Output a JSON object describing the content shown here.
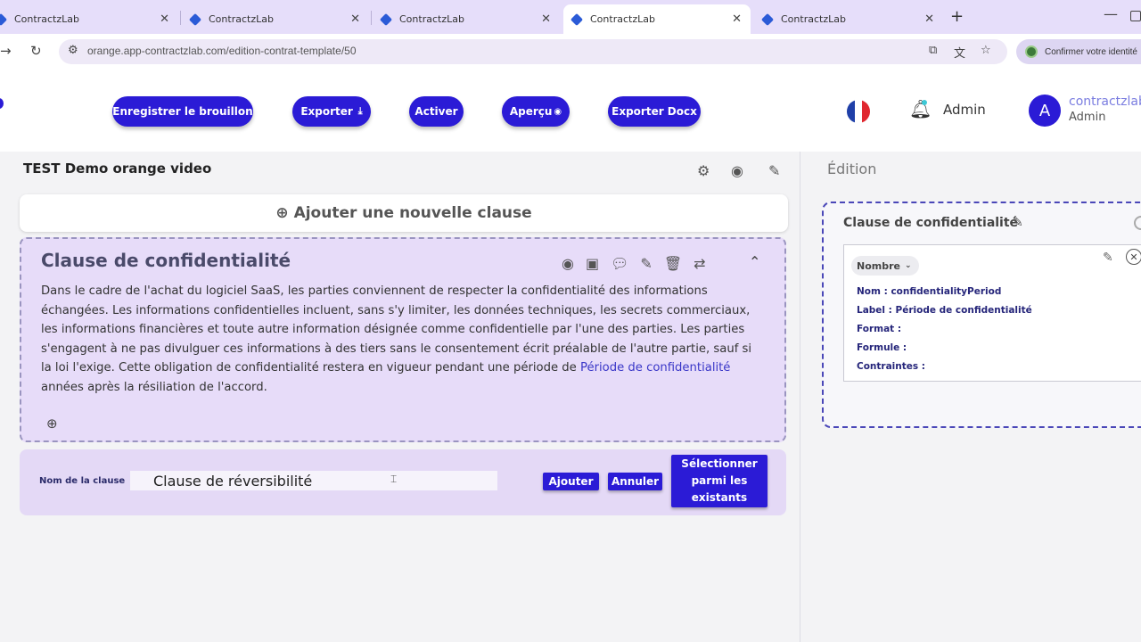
{
  "browser": {
    "tabs": [
      {
        "title": "ContractzLab",
        "close": "✕"
      },
      {
        "title": "ContractzLab",
        "close": "✕"
      },
      {
        "title": "ContractzLab",
        "close": "✕"
      },
      {
        "title": "ContractzLab",
        "close": "✕"
      },
      {
        "title": "ContractzLab",
        "close": "✕"
      }
    ],
    "active_tab_index": 3,
    "new_tab": "+",
    "url": "orange.app-contractzlab.com/edition-contrat-template/50",
    "identity_prompt": "Confirmer votre identité"
  },
  "header": {
    "buttons": {
      "save_draft": "Enregistrer le brouillon",
      "export": "Exporter",
      "activate": "Activer",
      "preview": "Aperçu",
      "export_docx": "Exporter Docx"
    },
    "admin_label": "Admin",
    "avatar_initial": "A",
    "user_name": "contractzlab",
    "user_role": "Admin"
  },
  "document": {
    "title": "TEST Demo orange video",
    "add_clause": "Ajouter une nouvelle clause"
  },
  "clause": {
    "title": "Clause de confidentialité",
    "body_before": "Dans le cadre de l'achat du logiciel SaaS, les parties conviennent de respecter la confidentialité des informations échangées. Les informations confidentielles incluent, sans s'y limiter, les données techniques, les secrets commerciaux, les informations financières et toute autre information désignée comme confidentielle par l'une des parties. Les parties s'engagent à ne pas divulguer ces informations à des tiers sans le consentement écrit préalable de l'autre partie, sauf si la loi l'exige. Cette obligation de confidentialité restera en vigueur pendant une période de ",
    "body_variable": "Période de confidentialité",
    "body_after": " années après la résiliation de l'accord."
  },
  "new_clause_form": {
    "label": "Nom de la clause",
    "value": "Clause de réversibilité",
    "add": "Ajouter",
    "cancel": "Annuler",
    "select_existing": "Sélectionner parmi les existants"
  },
  "side_panel": {
    "title": "Édition",
    "card_title": "Clause de confidentialité",
    "variable": {
      "type": "Nombre",
      "name_line": "Nom : confidentialityPeriod",
      "label_line": "Label : Période de confidentialité",
      "format_line": "Format :",
      "formula_line": "Formule :",
      "constraints_line": "Contraintes :"
    }
  },
  "colors": {
    "primary": "#2b1bd6",
    "clause_bg": "#e7dcf9",
    "tabbar_bg": "#e6defa"
  }
}
